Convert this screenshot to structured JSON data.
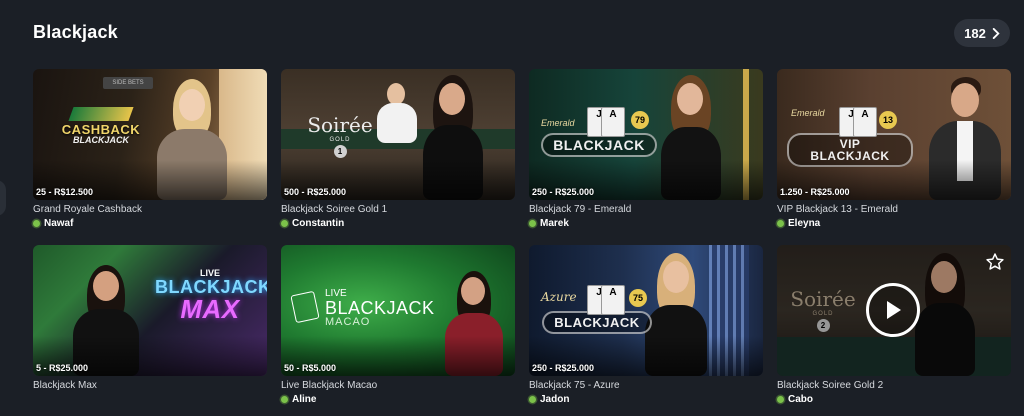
{
  "section": {
    "title": "Blackjack"
  },
  "count_button": {
    "label": "182",
    "icon": "chevron-right-icon"
  },
  "games": [
    {
      "limits": "25 - R$12.500",
      "name": "Grand Royale Cashback",
      "dealer": "Nawaf",
      "logo_line1": "CASHBACK",
      "logo_line2": "BLACKJACK",
      "table_sign": "SIDE BETS"
    },
    {
      "limits": "500 - R$25.000",
      "name": "Blackjack Soiree Gold 1",
      "dealer": "Constantin",
      "logo_line1": "Soirée",
      "logo_line2": "GOLD",
      "logo_num": "1"
    },
    {
      "limits": "250 - R$25.000",
      "name": "Blackjack 79 - Emerald",
      "dealer": "Marek",
      "logo_line1": "Emerald",
      "logo_line2": "BLACKJACK",
      "logo_num": "79"
    },
    {
      "limits": "1.250 - R$25.000",
      "name": "VIP Blackjack 13 - Emerald",
      "dealer": "Eleyna",
      "logo_line1": "Emerald",
      "logo_line2": "VIP BLACKJACK",
      "logo_num": "13"
    },
    {
      "limits": "5 - R$25.000",
      "name": "Blackjack Max",
      "dealer": "",
      "logo_line1": "LIVE",
      "logo_line2": "BLACKJACK",
      "logo_line3": "MAX"
    },
    {
      "limits": "50 - R$5.000",
      "name": "Live Blackjack Macao",
      "dealer": "Aline",
      "logo_line1": "LIVE",
      "logo_line2": "BLACKJACK",
      "logo_line3": "MACAO"
    },
    {
      "limits": "250 - R$25.000",
      "name": "Blackjack 75 - Azure",
      "dealer": "Jadon",
      "logo_line1": "Azure",
      "logo_line2": "BLACKJACK",
      "logo_num": "75"
    },
    {
      "limits": "",
      "name": "Blackjack Soiree Gold 2",
      "dealer": "Cabo",
      "logo_line1": "Soirée",
      "logo_line2": "GOLD",
      "logo_num": "2"
    }
  ],
  "colors": {
    "page_bg": "#1b1f26",
    "online": "#7cc24a",
    "pill_bg": "#2e333c"
  }
}
